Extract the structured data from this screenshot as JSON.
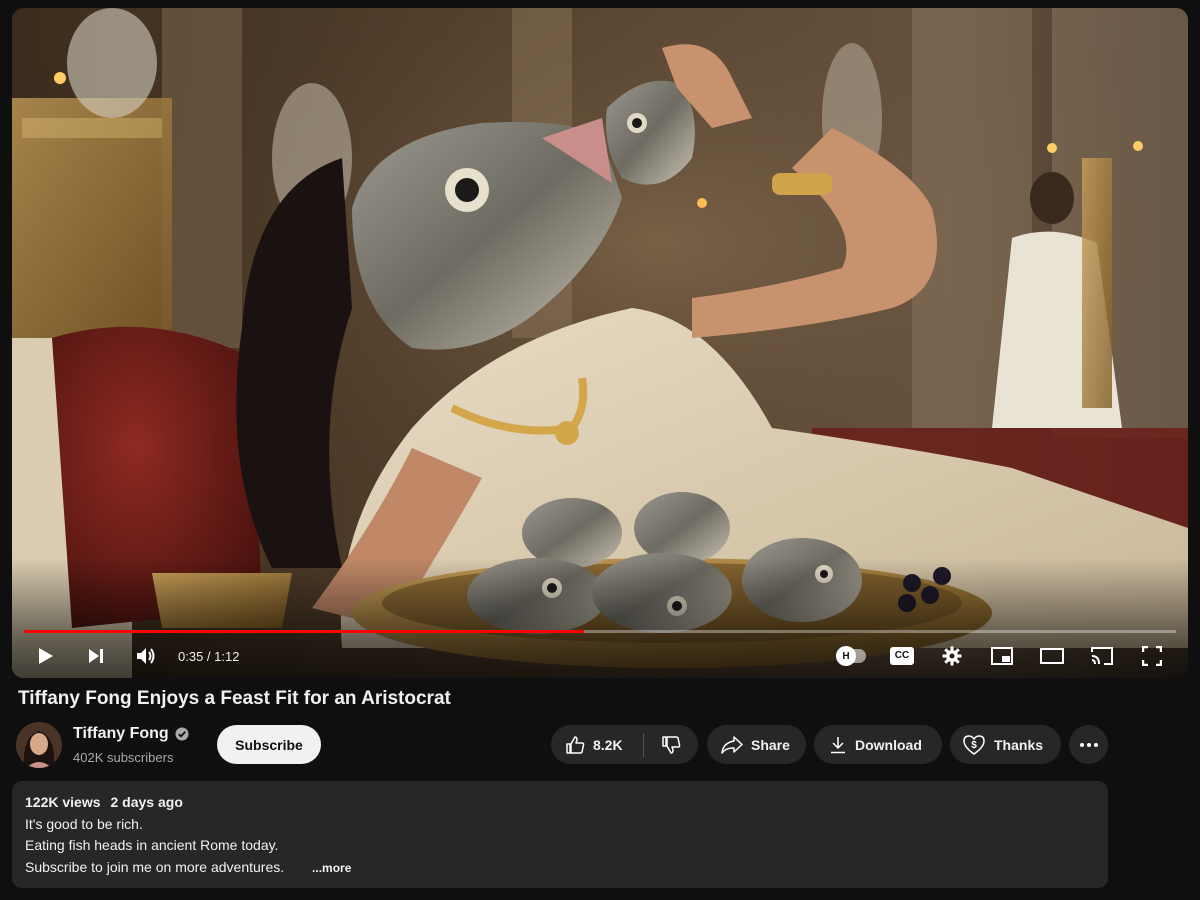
{
  "player": {
    "time_current": "0:35",
    "time_total": "1:12",
    "time_display": "0:35 / 1:12",
    "progress_fraction": 0.486,
    "hd_badge": "H",
    "cc_label": "CC",
    "accent_color": "#ff0000"
  },
  "video": {
    "title": "Tiffany Fong Enjoys a Feast Fit for an Aristocrat"
  },
  "channel": {
    "name": "Tiffany Fong",
    "subscribers": "402K subscribers",
    "subscribe_label": "Subscribe",
    "verified_icon": "verified-check-icon"
  },
  "actions": {
    "like_count": "8.2K",
    "share_label": "Share",
    "download_label": "Download",
    "thanks_label": "Thanks"
  },
  "description": {
    "views": "122K views",
    "date": "2 days ago",
    "lines": [
      "It's good to be rich.",
      "Eating fish heads in ancient Rome today.",
      "Subscribe to join me on more adventures."
    ],
    "more_label": "...more"
  }
}
